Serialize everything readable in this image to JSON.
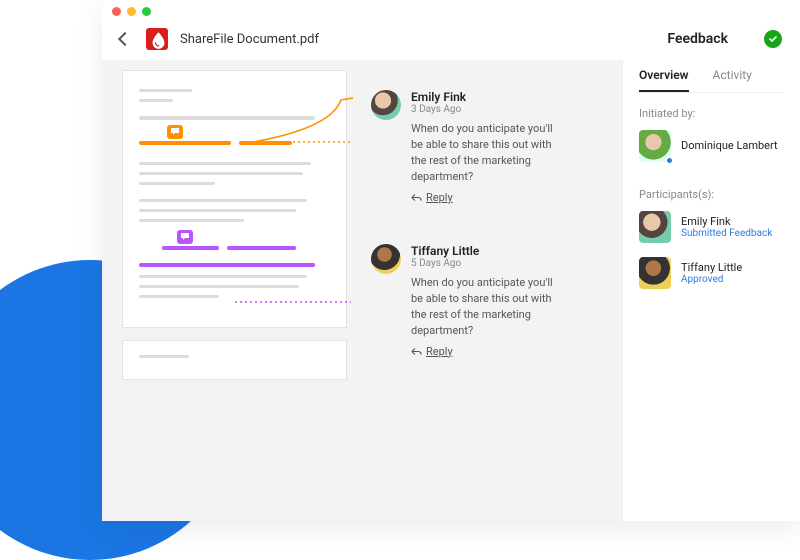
{
  "header": {
    "doc_title": "ShareFile Document.pdf",
    "feedback_label": "Feedback"
  },
  "comments": [
    {
      "name": "Emily Fink",
      "time": "3 Days Ago",
      "text": "When do you anticipate you'll be able to share this out with the rest of the marketing department?",
      "reply_label": "Reply"
    },
    {
      "name": "Tiffany Little",
      "time": "5 Days Ago",
      "text": "When do you anticipate you'll be able to share this out with the rest of the marketing department?",
      "reply_label": "Reply"
    }
  ],
  "sidebar": {
    "tabs": {
      "overview": "Overview",
      "activity": "Activity"
    },
    "initiated_label": "Initiated by:",
    "initiator": {
      "name": "Dominique Lambert"
    },
    "participants_label": "Participants(s):",
    "participants": [
      {
        "name": "Emily Fink",
        "status": "Submitted Feedback"
      },
      {
        "name": "Tiffany Little",
        "status": "Approved"
      }
    ]
  },
  "colors": {
    "annotation_orange": "#ff9100",
    "annotation_purple": "#b955ff"
  }
}
